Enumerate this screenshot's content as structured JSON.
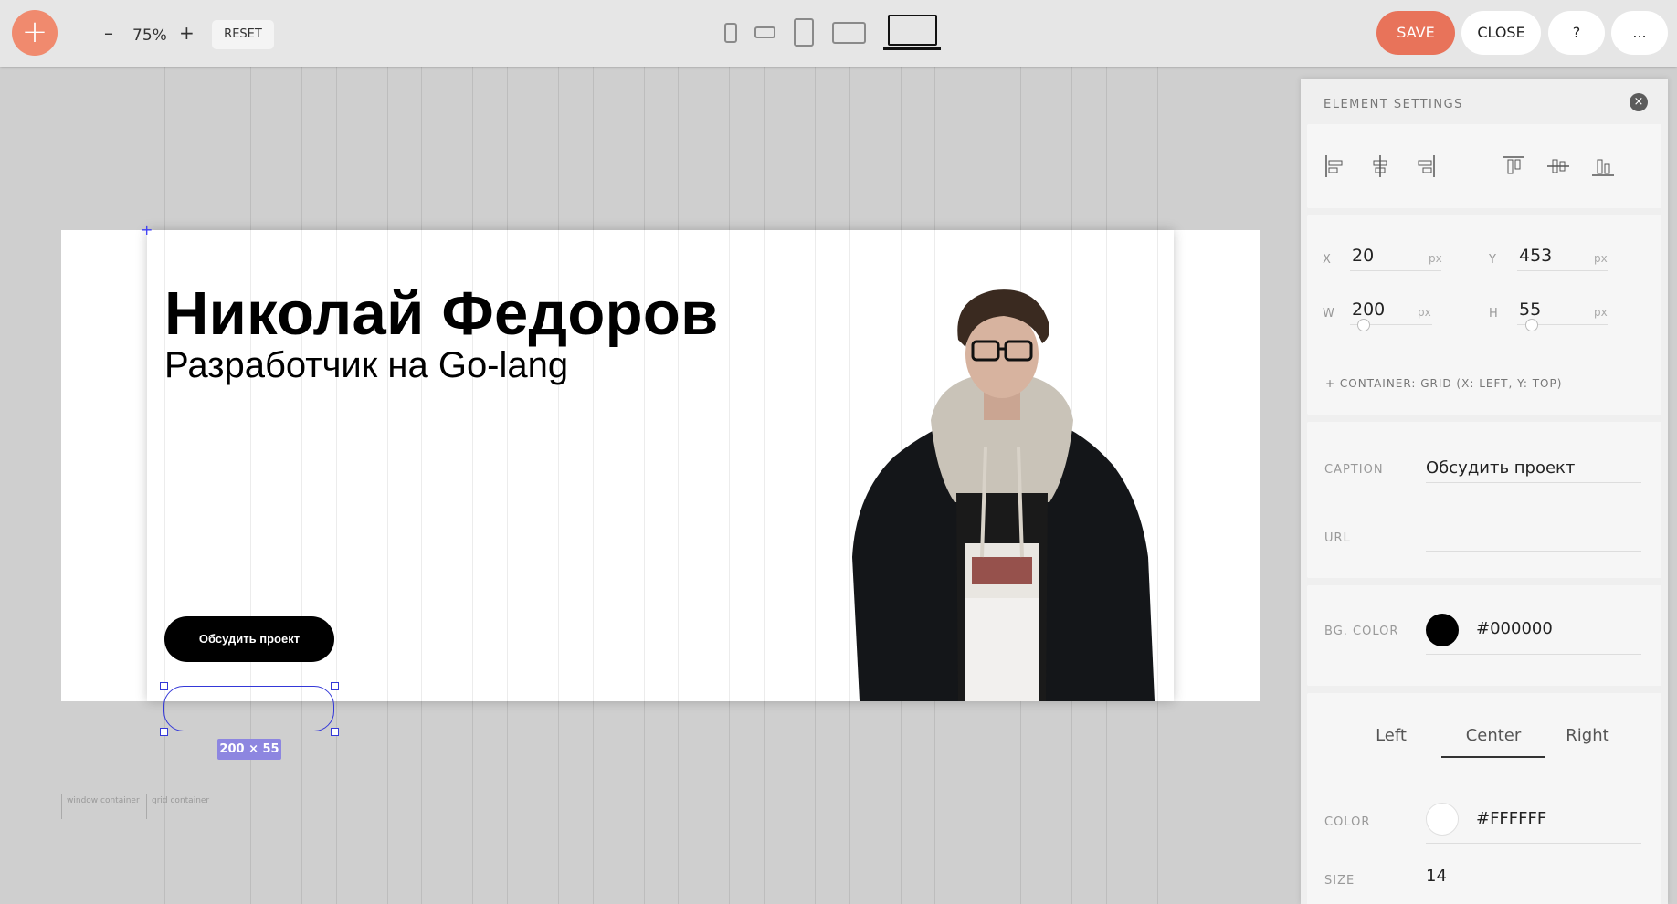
{
  "toolbar": {
    "add_label": "+",
    "zoom_minus": "–",
    "zoom_value": "75%",
    "zoom_plus": "+",
    "reset_label": "RESET",
    "save_label": "SAVE",
    "close_label": "CLOSE",
    "help_label": "?",
    "more_label": "...",
    "accent_color": "#E8735A",
    "device_icons": [
      "phone-icon",
      "phone-landscape-icon",
      "tablet-icon",
      "tablet-landscape-icon",
      "laptop-icon"
    ],
    "active_device": "laptop-icon"
  },
  "canvas": {
    "title": "Николай Федоров",
    "subtitle": "Разработчик на Go-lang",
    "button_label": "Обсудить проект",
    "size_badge": "200 × 55",
    "window_container_label": "window container",
    "grid_container_label": "grid container",
    "origin_marker": "+"
  },
  "settings": {
    "heading": "ELEMENT SETTINGS",
    "close_icon": "×",
    "align_icons": [
      "align-left-icon",
      "align-center-icon",
      "align-right-icon",
      "align-top-icon",
      "align-middle-icon",
      "align-bottom-icon"
    ],
    "x_label": "X",
    "x_value": "20",
    "x_unit": "px",
    "y_label": "Y",
    "y_value": "453",
    "y_unit": "px",
    "w_label": "W",
    "w_value": "200",
    "w_unit": "px",
    "h_label": "H",
    "h_value": "55",
    "h_unit": "px",
    "container_info": "+ CONTAINER: GRID (X: LEFT, Y: TOP)",
    "caption_label": "CAPTION",
    "caption_value": "Обсудить проект",
    "url_label": "URL",
    "url_value": "",
    "bg_color_label": "BG. COLOR",
    "bg_color_value": "#000000",
    "tabs": [
      "Left",
      "Center",
      "Right"
    ],
    "active_tab": "Center",
    "color_label": "COLOR",
    "color_value": "#FFFFFF",
    "size_label": "SIZE",
    "size_value": "14"
  }
}
